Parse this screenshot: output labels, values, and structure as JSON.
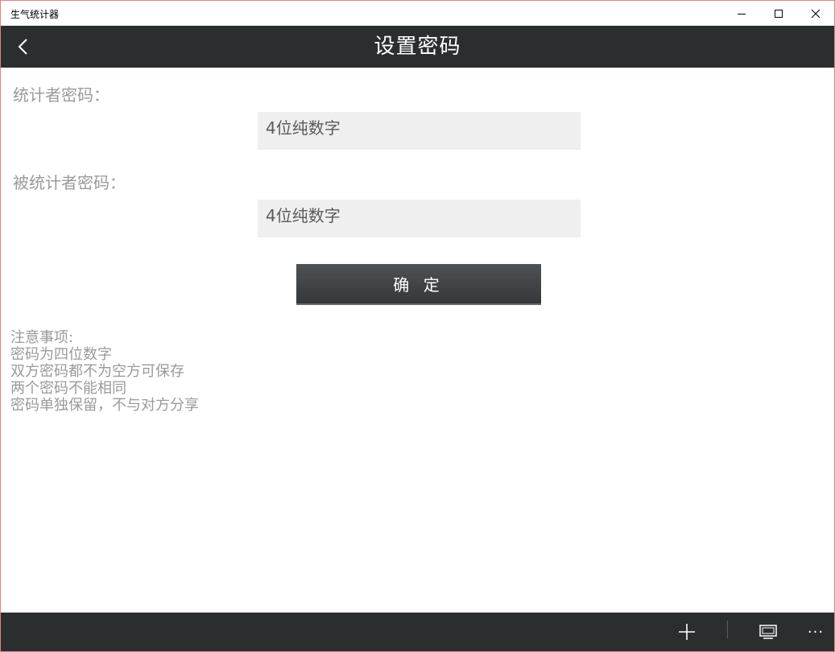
{
  "window": {
    "title": "生气统计器"
  },
  "header": {
    "title": "设置密码"
  },
  "form": {
    "counter_label": "统计者密码：",
    "counter_placeholder": "4位纯数字",
    "counted_label": "被统计者密码：",
    "counted_placeholder": "4位纯数字",
    "confirm_label": "确 定"
  },
  "notes": {
    "heading": "注意事项:",
    "items": [
      "密码为四位数字",
      "双方密码都不为空方可保存",
      "两个密码不能相同",
      "密码单独保留，不与对方分享"
    ]
  },
  "appbar": {
    "more_label": "···"
  },
  "colors": {
    "header_bg": "#2b2e2f",
    "label_text": "#9a9a9a",
    "input_bg": "#efefef",
    "button_bg": "#3e4244",
    "window_border": "#d8848a"
  }
}
